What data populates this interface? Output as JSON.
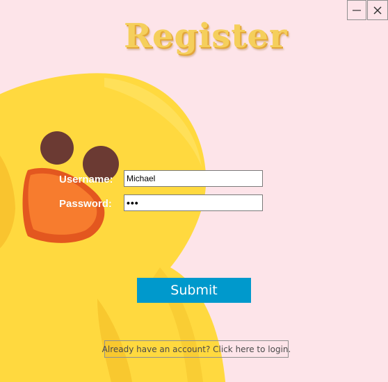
{
  "window": {
    "minimize_icon": "minimize-icon",
    "close_icon": "close-icon",
    "background_color": "#fde4e9"
  },
  "title": "Register",
  "form": {
    "username_label": "Username:",
    "username_value": "Michael",
    "password_label": "Password:",
    "password_value": "•••"
  },
  "submit_label": "Submit",
  "login_link": "Already have an account? Click here to login.",
  "colors": {
    "title": "#f5cf5c",
    "submit_button": "#0099cc",
    "mascot_body": "#ffd93f",
    "mascot_beak": "#f77c2e"
  }
}
